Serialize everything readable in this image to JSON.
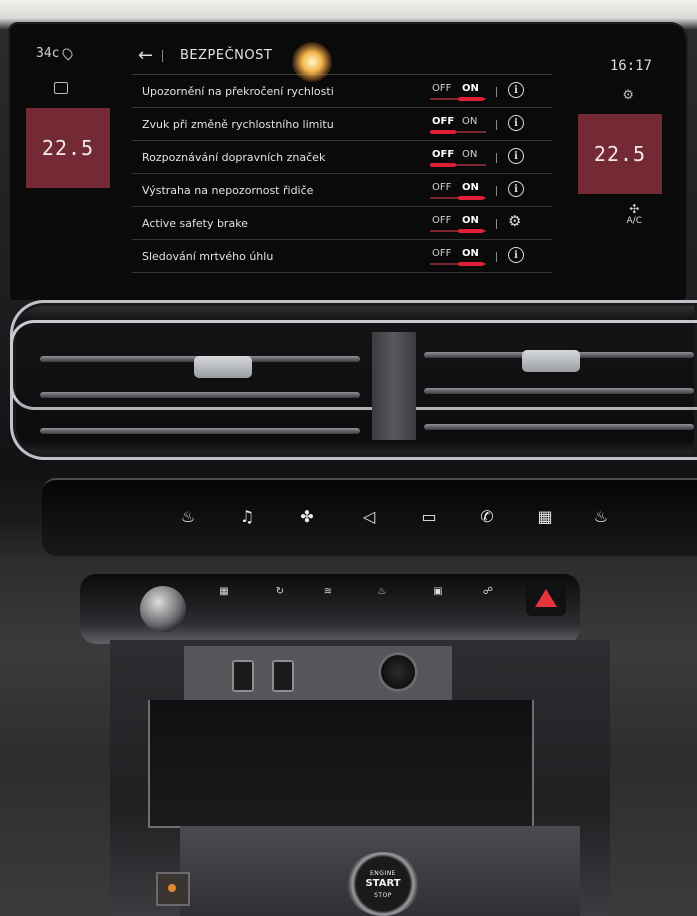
{
  "screen": {
    "outside_temp": "34c",
    "clock": "16:17",
    "left_temp": "22.5",
    "right_temp": "22.5",
    "ac_label": "A/C",
    "title": "BEZPEČNOST",
    "rows": [
      {
        "label": "Upozornění na překročení rychlosti",
        "off": "OFF",
        "on": "ON",
        "state": "on",
        "action": "info-icon"
      },
      {
        "label": "Zvuk při změně rychlostního limitu",
        "off": "OFF",
        "on": "ON",
        "state": "off",
        "action": "info-icon"
      },
      {
        "label": "Rozpoznávání dopravních značek",
        "off": "OFF",
        "on": "ON",
        "state": "off",
        "action": "info-icon"
      },
      {
        "label": "Výstraha na nepozornost řidiče",
        "off": "OFF",
        "on": "ON",
        "state": "on",
        "action": "info-icon"
      },
      {
        "label": "Active safety brake",
        "off": "OFF",
        "on": "ON",
        "state": "on",
        "action": "gear-icon"
      },
      {
        "label": "Sledování mrtvého úhlu",
        "off": "OFF",
        "on": "ON",
        "state": "on",
        "action": "info-icon"
      }
    ],
    "colors": {
      "accent": "#e01f36",
      "temp_box": "#742a34"
    }
  },
  "touchbar_icons": [
    "seat-heat-icon",
    "music-icon",
    "fan-icon",
    "navigation-icon",
    "car-icon",
    "phone-icon",
    "apps-icon",
    "seat-heat-right-icon"
  ],
  "lower_icons": [
    "rear-defrost-icon",
    "recirculation-icon",
    "front-defrost-icon",
    "seat-vent-icon",
    "lock-icon",
    "child-lock-icon"
  ],
  "start_button": {
    "line1": "ENGINE",
    "line2": "START",
    "line3": "STOP"
  }
}
